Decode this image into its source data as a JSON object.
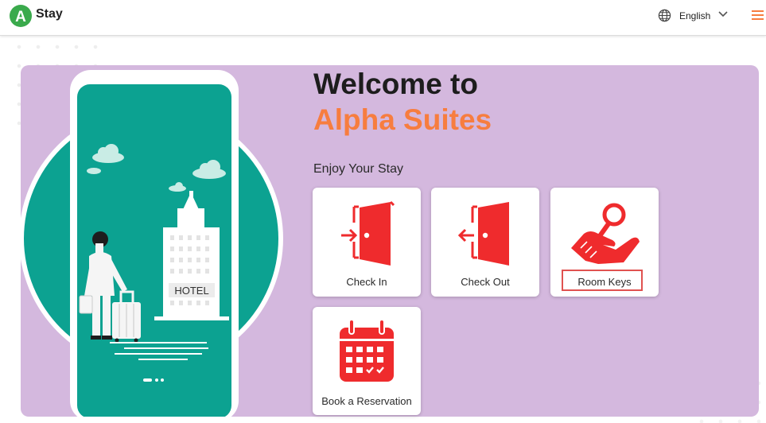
{
  "header": {
    "brand": "Stay",
    "logo_letter": "A",
    "language": "English"
  },
  "hero": {
    "welcome": "Welcome to",
    "hotel_name": "Alpha Suites",
    "subtitle": "Enjoy Your Stay",
    "building_sign": "HOTEL"
  },
  "actions": [
    {
      "label": "Check In",
      "icon": "door-enter-icon"
    },
    {
      "label": "Check Out",
      "icon": "door-exit-icon"
    },
    {
      "label": "Room Keys",
      "icon": "key-hand-icon",
      "highlighted": true
    },
    {
      "label": "Book a Reservation",
      "icon": "calendar-icon"
    }
  ],
  "colors": {
    "accent_orange": "#f77d3f",
    "panel_purple": "#d4b8de",
    "teal": "#0ca291",
    "icon_red": "#ef2b2d",
    "logo_green": "#3aaa4c"
  }
}
